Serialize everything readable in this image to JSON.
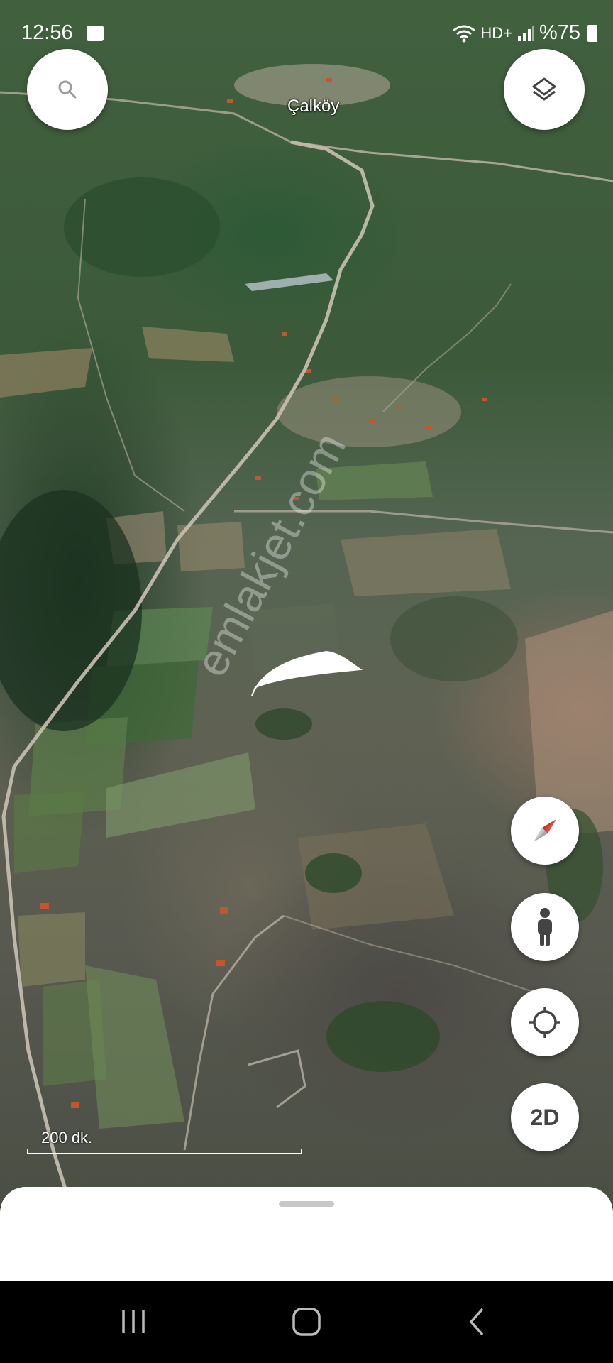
{
  "status_bar": {
    "time": "12:56",
    "network": "HD+",
    "battery": "%75",
    "icons": [
      "image-icon",
      "wifi-icon",
      "signal-icon",
      "battery-icon"
    ]
  },
  "map": {
    "place_label": "Çalköy",
    "watermark": "emlakjet.com",
    "scale_label": "200 dk."
  },
  "buttons": {
    "search_icon": "search-icon",
    "layers_icon": "layers-icon",
    "compass_icon": "compass-icon",
    "street_view_icon": "pegman-icon",
    "location_icon": "my-location-icon",
    "view_mode_label": "2D"
  },
  "nav_bar": [
    "recent-apps-icon",
    "home-icon",
    "back-icon"
  ],
  "colors": {
    "button_bg": "#ffffff",
    "icon_gray": "#5f6368",
    "compass_red": "#e8453c",
    "sheet_bg": "#ffffff",
    "nav_bg": "#000000"
  }
}
